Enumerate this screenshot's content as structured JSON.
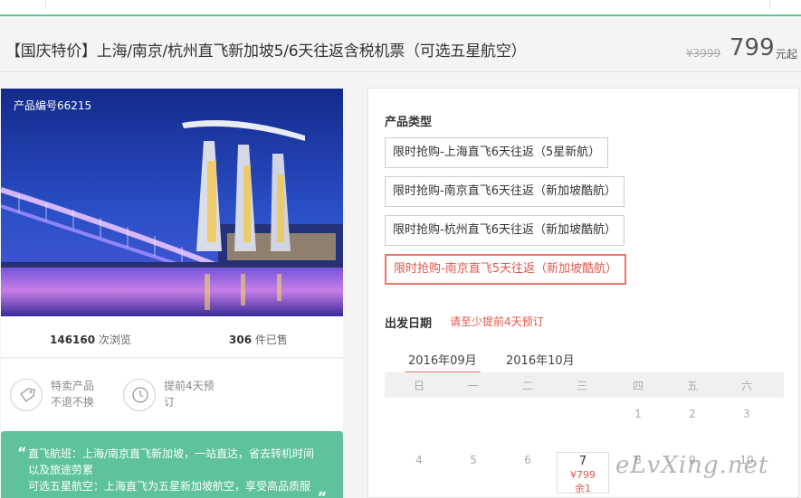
{
  "title": "【国庆特价】上海/南京/杭州直飞新加坡5/6天往返含税机票（可选五星航空）",
  "price": {
    "original": "¥3999",
    "current": "799",
    "unit": "元起"
  },
  "product": {
    "id_label": "产品编号66215"
  },
  "stats": {
    "views": "146160",
    "views_label": " 次浏览",
    "sold": "306",
    "sold_label": " 件已售"
  },
  "features": [
    {
      "icon": "tag-icon",
      "line1": "特卖产品",
      "line2": "不退不换"
    },
    {
      "icon": "clock-icon",
      "line1": "提前4天预",
      "line2": "订"
    }
  ],
  "quote": {
    "open": "“",
    "close": "„",
    "lines": [
      "直飞航班：上海/南京直飞新加坡，一站直达，省去转机时间",
      "以及旅途劳累",
      "可选五星航空：上海直飞为五星新加坡航空，享受高品质服"
    ]
  },
  "product_type": {
    "label": "产品类型",
    "options": [
      "限时抢购-上海直飞6天往返（5星新航）",
      "限时抢购-南京直飞6天往返（新加坡酷航）",
      "限时抢购-杭州直飞6天往返（新加坡酷航）",
      "限时抢购-南京直飞5天往返（新加坡酷航）"
    ],
    "selected_index": 3
  },
  "departure": {
    "label": "出发日期",
    "hint": "请至少提前4天预订",
    "months": [
      "2016年09月",
      "2016年10月"
    ],
    "active_month": 0,
    "weekdays": [
      "日",
      "一",
      "二",
      "三",
      "四",
      "五",
      "六"
    ],
    "row1": [
      "1",
      "2",
      "3"
    ],
    "row2": [
      "4",
      "5",
      "6",
      "7",
      "8",
      "9",
      "10"
    ],
    "highlight_day": {
      "day": "7",
      "price": "¥799",
      "stock": "余1"
    }
  },
  "watermark": "eLvXing.net",
  "colors": {
    "accent_green": "#5ec39c",
    "accent_red": "#e2574c",
    "price_gray": "#555555"
  }
}
